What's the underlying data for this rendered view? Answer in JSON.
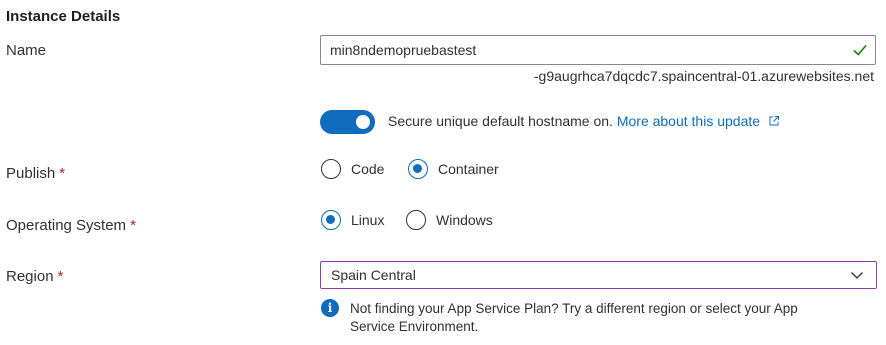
{
  "section": {
    "title": "Instance Details"
  },
  "name": {
    "label": "Name",
    "value": "min8ndemopruebastest",
    "suffix": "-g9augrhca7dqcdc7.spaincentral-01.azurewebsites.net",
    "valid_icon": "check-icon"
  },
  "hostname_toggle": {
    "state": "on",
    "text": "Secure unique default hostname on.",
    "link_text": "More about this update",
    "link_icon": "external-link-icon"
  },
  "publish": {
    "label": "Publish",
    "required_mark": "*",
    "options": [
      "Code",
      "Container"
    ],
    "selected": "Container"
  },
  "os": {
    "label": "Operating System",
    "required_mark": "*",
    "options": [
      "Linux",
      "Windows"
    ],
    "selected": "Linux"
  },
  "region": {
    "label": "Region",
    "required_mark": "*",
    "value": "Spain Central",
    "dropdown_icon": "chevron-down-icon"
  },
  "info": {
    "icon": "info-icon",
    "glyph": "i",
    "text_line1": "Not finding your App Service Plan? Try a different region or select your App",
    "text_line2": "Service Environment."
  },
  "colors": {
    "accent": "#0f6cbd",
    "required": "#a4262c",
    "valid": "#107c10",
    "focus_border": "#8b3fa8"
  }
}
